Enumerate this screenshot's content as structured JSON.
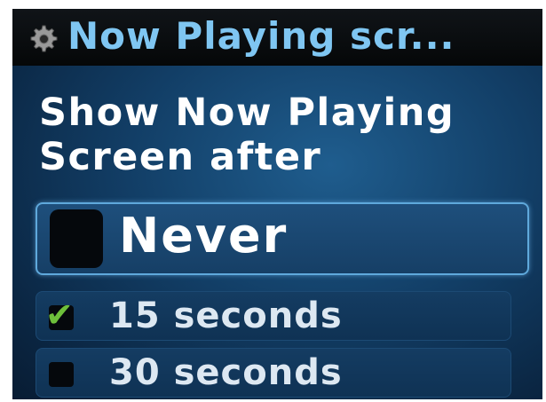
{
  "title_bar": {
    "icon": "gear-icon",
    "title": "Now Playing scr..."
  },
  "heading": {
    "line1": "Show Now Playing",
    "line2": "Screen after"
  },
  "options": [
    {
      "label": "Never",
      "checked": false,
      "highlighted": true
    },
    {
      "label": "15 seconds",
      "checked": true,
      "highlighted": false
    },
    {
      "label": "30 seconds",
      "checked": false,
      "highlighted": false
    }
  ],
  "colors": {
    "title_text": "#7fc6f2",
    "checkmark": "#6dbf3b",
    "highlight_border": "#5fa9dc",
    "background": "#123e66"
  }
}
